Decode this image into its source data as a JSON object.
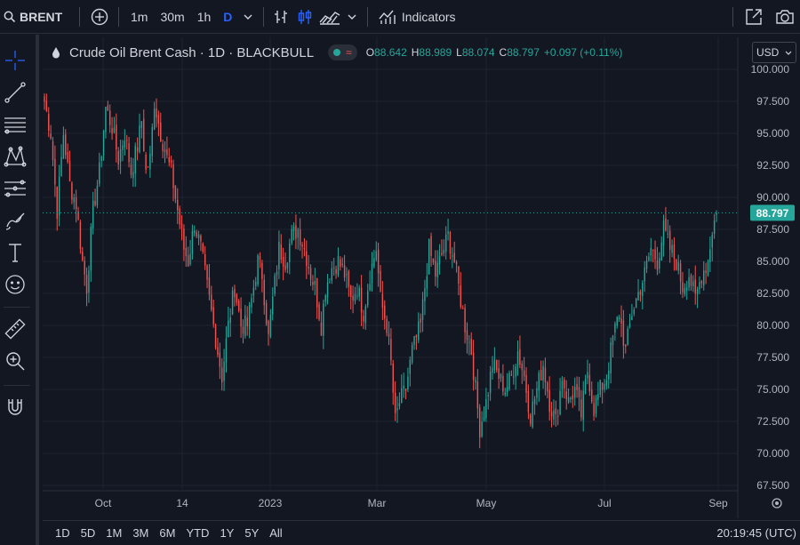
{
  "toolbar": {
    "symbol": "BRENT",
    "intervals": [
      "1m",
      "30m",
      "1h",
      "D"
    ],
    "active_interval": "D",
    "indicators_label": "Indicators"
  },
  "legend": {
    "title": "Crude Oil Brent Cash · 1D · BLACKBULL",
    "open_label": "O",
    "open": "88.642",
    "high_label": "H",
    "high": "88.989",
    "low_label": "L",
    "low": "88.074",
    "close_label": "C",
    "close": "88.797",
    "change": "+0.097 (+0.11%)"
  },
  "currency": "USD",
  "price_axis": [
    "100.000",
    "97.500",
    "95.000",
    "92.500",
    "90.000",
    "87.500",
    "85.000",
    "82.500",
    "80.000",
    "77.500",
    "75.000",
    "72.500",
    "70.000",
    "67.500"
  ],
  "time_axis": [
    "Oct",
    "14",
    "2023",
    "Mar",
    "May",
    "Jul",
    "Sep"
  ],
  "last_price": "88.797",
  "ranges": [
    "1D",
    "5D",
    "1M",
    "3M",
    "6M",
    "YTD",
    "1Y",
    "5Y",
    "All"
  ],
  "clock": "20:19:45 (UTC)",
  "colors": {
    "up": "#26a69a",
    "down": "#ef5350",
    "background": "#131722",
    "grid": "#1f2330",
    "accent": "#2962ff"
  },
  "chart_data": {
    "type": "candlestick",
    "y_min": 67.5,
    "y_max": 100,
    "anchors": [
      [
        0,
        97.5
      ],
      [
        3,
        95
      ],
      [
        6,
        89
      ],
      [
        9,
        95
      ],
      [
        12,
        91
      ],
      [
        15,
        89.5
      ],
      [
        18,
        85
      ],
      [
        20,
        83
      ],
      [
        23,
        89
      ],
      [
        26,
        92
      ],
      [
        29,
        97
      ],
      [
        32,
        95.5
      ],
      [
        35,
        93
      ],
      [
        38,
        95
      ],
      [
        41,
        92
      ],
      [
        44,
        94
      ],
      [
        46,
        96
      ],
      [
        48,
        92
      ],
      [
        50,
        93
      ],
      [
        52,
        97.5
      ],
      [
        55,
        95
      ],
      [
        58,
        93
      ],
      [
        60,
        92
      ],
      [
        62,
        90
      ],
      [
        64,
        88
      ],
      [
        66,
        86
      ],
      [
        68,
        85
      ],
      [
        71,
        88
      ],
      [
        74,
        86
      ],
      [
        77,
        83
      ],
      [
        80,
        80
      ],
      [
        82,
        78
      ],
      [
        84,
        76
      ],
      [
        87,
        80
      ],
      [
        90,
        83
      ],
      [
        93,
        80
      ],
      [
        96,
        80
      ],
      [
        99,
        83
      ],
      [
        101,
        85
      ],
      [
        103,
        84
      ],
      [
        106,
        79
      ],
      [
        108,
        82
      ],
      [
        111,
        86
      ],
      [
        114,
        85
      ],
      [
        117,
        87
      ],
      [
        120,
        87.5
      ],
      [
        123,
        86
      ],
      [
        126,
        84
      ],
      [
        128,
        83
      ],
      [
        131,
        80
      ],
      [
        133,
        83
      ],
      [
        136,
        84.5
      ],
      [
        139,
        85
      ],
      [
        142,
        84
      ],
      [
        145,
        82
      ],
      [
        148,
        83
      ],
      [
        151,
        81
      ],
      [
        154,
        84
      ],
      [
        157,
        86
      ],
      [
        159,
        82
      ],
      [
        162,
        80
      ],
      [
        164,
        77
      ],
      [
        166,
        72.5
      ],
      [
        168,
        74
      ],
      [
        171,
        75
      ],
      [
        174,
        78
      ],
      [
        178,
        80
      ],
      [
        182,
        86
      ],
      [
        185,
        84
      ],
      [
        188,
        85.5
      ],
      [
        191,
        87
      ],
      [
        194,
        85
      ],
      [
        196,
        83
      ],
      [
        199,
        80
      ],
      [
        202,
        78
      ],
      [
        204,
        75
      ],
      [
        206,
        72
      ],
      [
        209,
        74
      ],
      [
        212,
        77
      ],
      [
        215,
        76
      ],
      [
        218,
        75
      ],
      [
        221,
        76
      ],
      [
        224,
        78
      ],
      [
        227,
        76
      ],
      [
        230,
        73
      ],
      [
        233,
        75
      ],
      [
        236,
        77
      ],
      [
        239,
        74
      ],
      [
        242,
        72.5
      ],
      [
        245,
        76
      ],
      [
        248,
        74
      ],
      [
        251,
        75
      ],
      [
        254,
        73
      ],
      [
        257,
        76.5
      ],
      [
        260,
        73.5
      ],
      [
        263,
        75
      ],
      [
        266,
        76
      ],
      [
        269,
        79
      ],
      [
        272,
        81
      ],
      [
        275,
        78
      ],
      [
        278,
        81
      ],
      [
        281,
        82.5
      ],
      [
        284,
        84
      ],
      [
        287,
        86
      ],
      [
        290,
        85
      ],
      [
        293,
        87.5
      ],
      [
        296,
        86
      ],
      [
        299,
        85
      ],
      [
        302,
        83
      ],
      [
        305,
        84
      ],
      [
        308,
        82
      ],
      [
        311,
        84
      ],
      [
        314,
        85
      ],
      [
        316,
        87.5
      ],
      [
        318,
        88.8
      ]
    ],
    "last": {
      "open": 88.642,
      "high": 88.989,
      "low": 88.074,
      "close": 88.797
    }
  }
}
